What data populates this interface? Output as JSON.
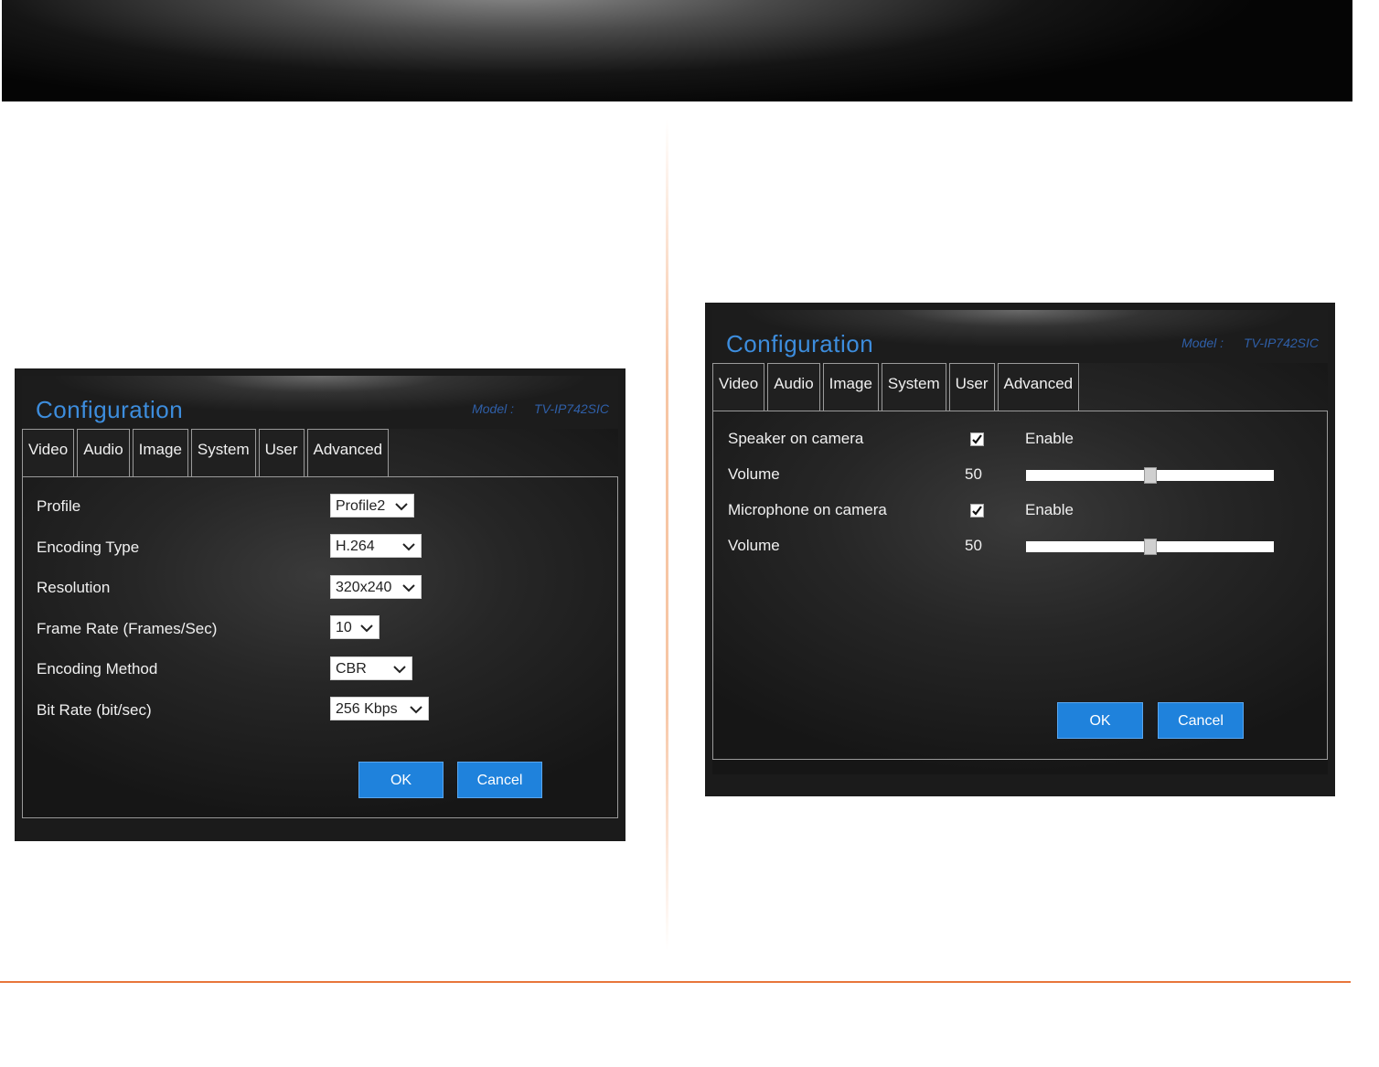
{
  "left_window": {
    "title": "Configuration",
    "model_label": "Model :",
    "model_value": "TV-IP742SIC",
    "tabs": [
      "Video",
      "Audio",
      "Image",
      "System",
      "User",
      "Advanced"
    ],
    "rows": [
      {
        "label": "Profile",
        "value": "Profile2"
      },
      {
        "label": "Encoding Type",
        "value": "H.264"
      },
      {
        "label": "Resolution",
        "value": "320x240"
      },
      {
        "label": "Frame Rate (Frames/Sec)",
        "value": "10"
      },
      {
        "label": "Encoding Method",
        "value": "CBR"
      },
      {
        "label": "Bit Rate (bit/sec)",
        "value": "256 Kbps"
      }
    ],
    "ok_label": "OK",
    "cancel_label": "Cancel"
  },
  "right_window": {
    "title": "Configuration",
    "model_label": "Model :",
    "model_value": "TV-IP742SIC",
    "tabs": [
      "Video",
      "Audio",
      "Image",
      "System",
      "User",
      "Advanced"
    ],
    "speaker_label": "Speaker on camera",
    "speaker_enabled": true,
    "speaker_enable_label": "Enable",
    "speaker_volume_label": "Volume",
    "speaker_volume": "50",
    "speaker_volume_fraction": 0.5,
    "mic_label": "Microphone on camera",
    "mic_enabled": true,
    "mic_enable_label": "Enable",
    "mic_volume_label": "Volume",
    "mic_volume": "50",
    "mic_volume_fraction": 0.5,
    "ok_label": "OK",
    "cancel_label": "Cancel"
  },
  "colors": {
    "title_blue": "#3d8ddd",
    "button_blue": "#1f82dc",
    "footer_orange": "#e8763a"
  }
}
